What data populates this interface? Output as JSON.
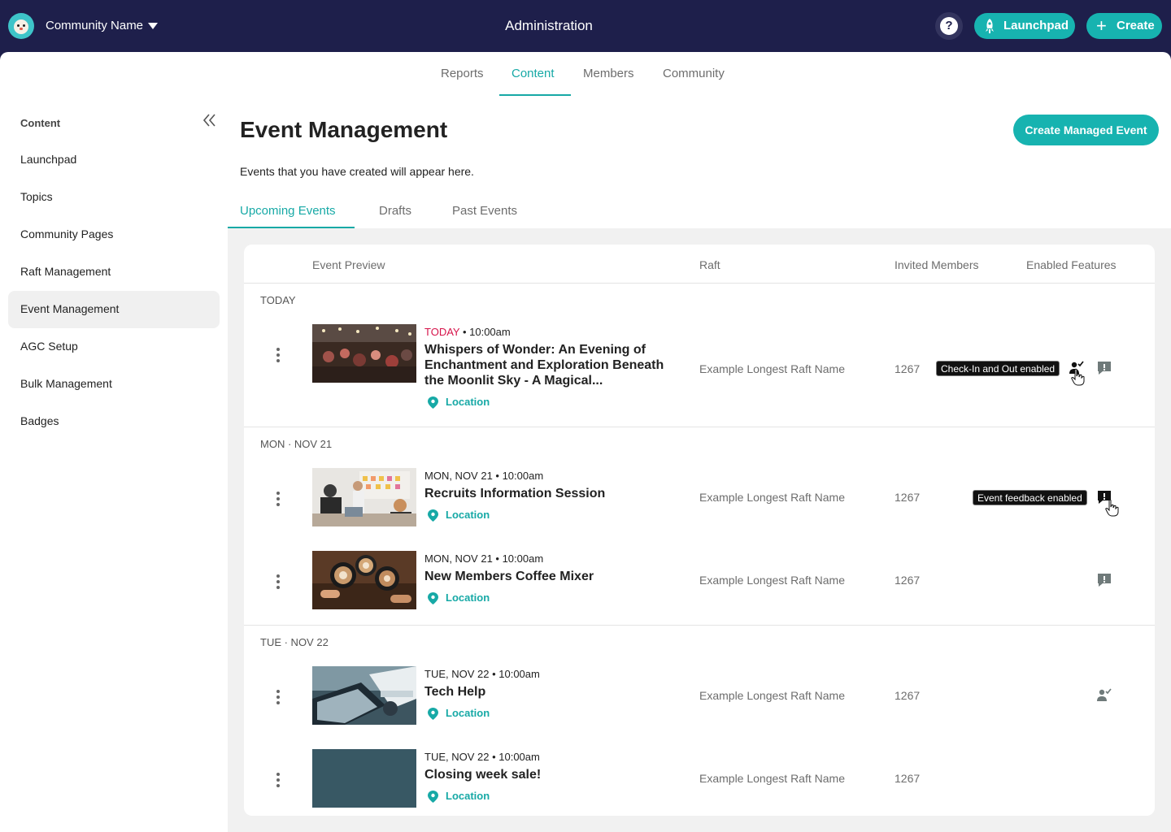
{
  "header": {
    "community_name": "Community Name",
    "title": "Administration",
    "help_label": "?",
    "launchpad_label": "Launchpad",
    "create_label": "Create",
    "create_plus": "+"
  },
  "top_nav": [
    "Reports",
    "Content",
    "Members",
    "Community"
  ],
  "sidebar": {
    "heading": "Content",
    "items": [
      "Launchpad",
      "Topics",
      "Community Pages",
      "Raft Management",
      "Event Management",
      "AGC Setup",
      "Bulk Management",
      "Badges"
    ]
  },
  "main": {
    "title": "Event Management",
    "create_button": "Create Managed Event",
    "subtitle": "Events that you have created will appear here.",
    "tabs": [
      "Upcoming Events",
      "Drafts",
      "Past Events"
    ]
  },
  "table": {
    "headers": [
      "Event Preview",
      "Raft",
      "Invited Members",
      "Enabled Features"
    ],
    "groups": [
      "TODAY",
      "MON · NOV 21",
      "TUE · NOV 22"
    ],
    "rows": [
      {
        "today_label": "TODAY",
        "date": " • 10:00am",
        "title": "Whispers of Wonder: An Evening of Enchantment and Exploration Beneath the Moonlit Sky - A Magical...",
        "location": "Location",
        "raft": "Example Longest Raft Name",
        "members": "1267",
        "tooltip": "Check-In and Out enabled"
      },
      {
        "date": "MON, NOV 21 • 10:00am",
        "title": "Recruits Information Session",
        "location": "Location",
        "raft": "Example Longest Raft Name",
        "members": "1267",
        "tooltip": "Event feedback enabled"
      },
      {
        "date": "MON, NOV 21 • 10:00am",
        "title": "New Members Coffee Mixer",
        "location": "Location",
        "raft": "Example Longest Raft Name",
        "members": "1267"
      },
      {
        "date": "TUE, NOV 22 • 10:00am",
        "title": "Tech Help",
        "location": "Location",
        "raft": "Example Longest Raft Name",
        "members": "1267"
      },
      {
        "date": "TUE, NOV 22 • 10:00am",
        "title": "Closing week sale!",
        "location": "Location",
        "raft": "Example Longest Raft Name",
        "members": "1267"
      }
    ]
  },
  "colors": {
    "header_bg": "#1e1f4b",
    "accent": "#17b3b0",
    "today_red": "#d6134a"
  }
}
